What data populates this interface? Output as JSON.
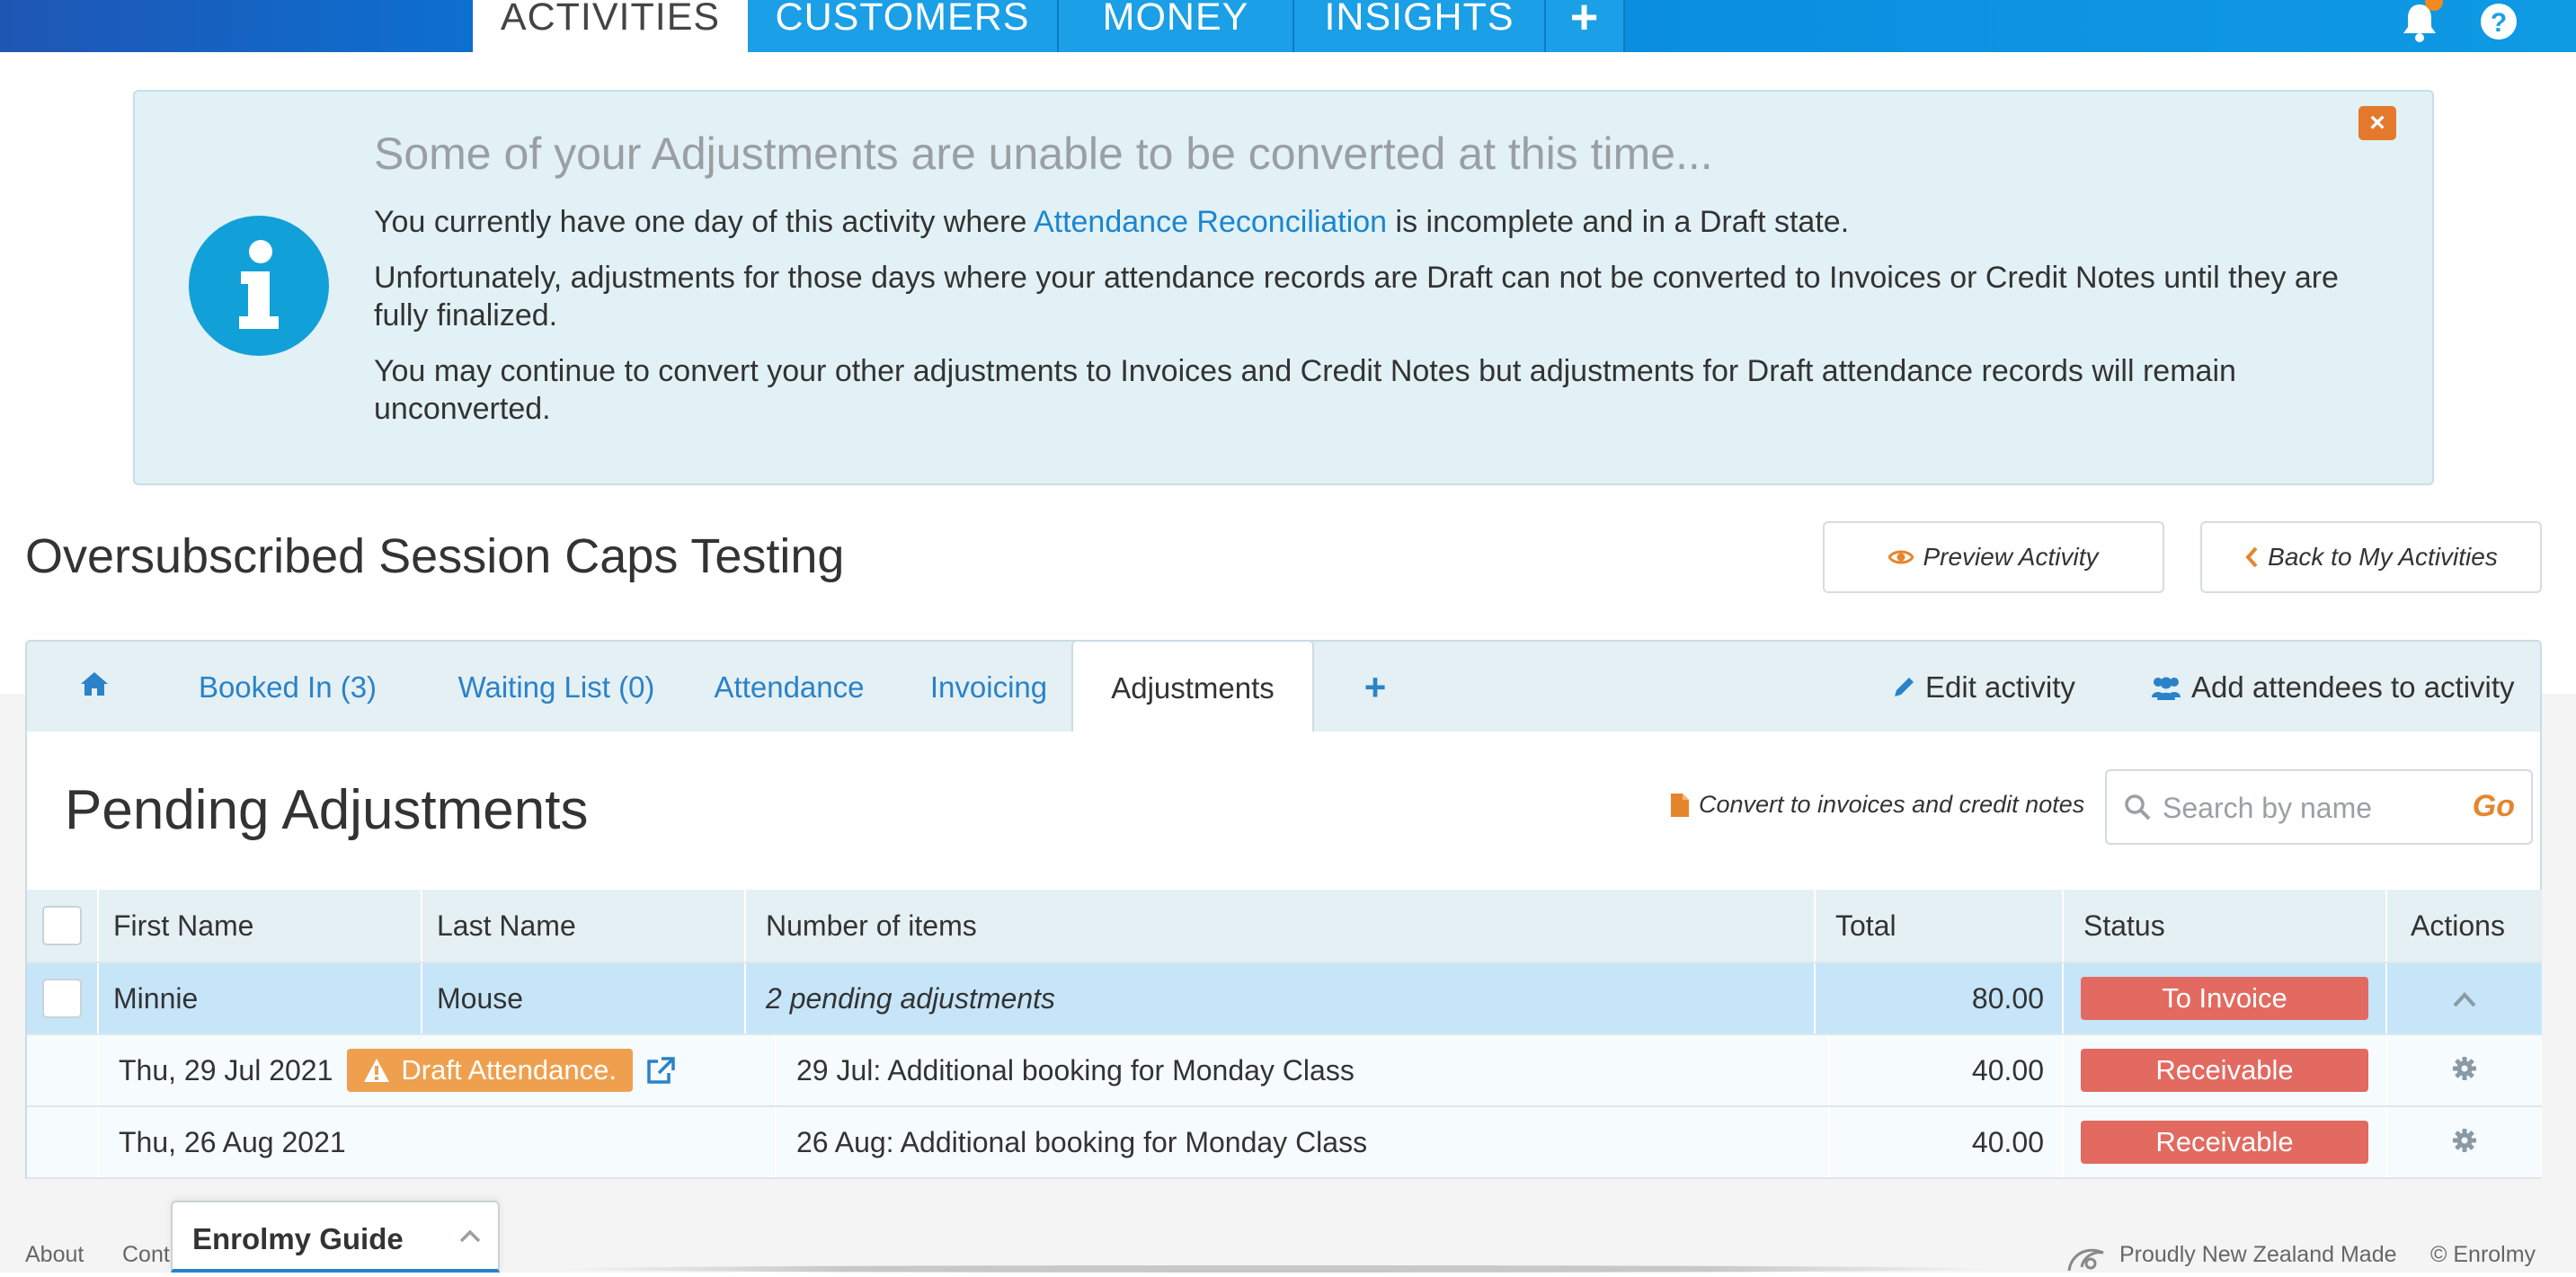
{
  "nav": {
    "tabs": [
      {
        "label": "ACTIVITIES",
        "active": true
      },
      {
        "label": "CUSTOMERS"
      },
      {
        "label": "MONEY"
      },
      {
        "label": "INSIGHTS"
      }
    ],
    "plus_label": "+",
    "icons": [
      "bell-icon",
      "help-icon"
    ]
  },
  "alert": {
    "title": "Some of your Adjustments are unable to be converted at this time...",
    "p1_before": "You currently have one day of this activity where ",
    "p1_link": "Attendance Reconciliation",
    "p1_after": " is incomplete and in a Draft state.",
    "p2": "Unfortunately, adjustments for those days where your attendance records are Draft can not be converted to Invoices or Credit Notes until they are fully finalized.",
    "p3": "You may continue to convert your other adjustments to Invoices and Credit Notes but adjustments for Draft attendance records will remain unconverted.",
    "close_label": "×",
    "icon": "info-icon"
  },
  "page": {
    "title": "Oversubscribed Session Caps Testing",
    "preview_label": "Preview Activity",
    "back_label": "Back to My Activities"
  },
  "tabs": {
    "items": [
      {
        "label": "Booked In (3)"
      },
      {
        "label": "Waiting List (0)"
      },
      {
        "label": "Attendance"
      },
      {
        "label": "Invoicing"
      },
      {
        "label": "Adjustments",
        "active": true
      }
    ],
    "plus_label": "+",
    "edit_label": "Edit activity",
    "add_attendees_label": "Add attendees to activity"
  },
  "section": {
    "title": "Pending Adjustments",
    "convert_label": "Convert to invoices and credit notes",
    "search_placeholder": "Search by name",
    "go_label": "Go"
  },
  "table": {
    "headers": {
      "first_name": "First Name",
      "last_name": "Last Name",
      "items": "Number of items",
      "total": "Total",
      "status": "Status",
      "actions": "Actions"
    },
    "main_row": {
      "first_name": "Minnie",
      "last_name": "Mouse",
      "items": "2 pending adjustments",
      "total": "80.00",
      "status": "To Invoice"
    },
    "sub_rows": [
      {
        "date": "Thu, 29 Jul 2021",
        "badge": "Draft Attendance.",
        "description": "29 Jul: Additional booking for Monday Class",
        "total": "40.00",
        "status": "Receivable"
      },
      {
        "date": "Thu, 26 Aug 2021",
        "description": "26 Aug: Additional booking for Monday Class",
        "total": "40.00",
        "status": "Receivable"
      }
    ]
  },
  "footer": {
    "about": "About",
    "contact": "Cont",
    "guide_label": "Enrolmy Guide",
    "nz_made": "Proudly New Zealand Made",
    "copyright": "© Enrolmy"
  },
  "colors": {
    "nav_blue": "#1b9fe6",
    "link_blue": "#2a82c9",
    "status_red": "#e26a60",
    "draft_orange": "#efa04f",
    "accent_orange": "#e5792b",
    "alert_bg": "#e2f1f5",
    "row_highlight": "#c6e5f9"
  }
}
